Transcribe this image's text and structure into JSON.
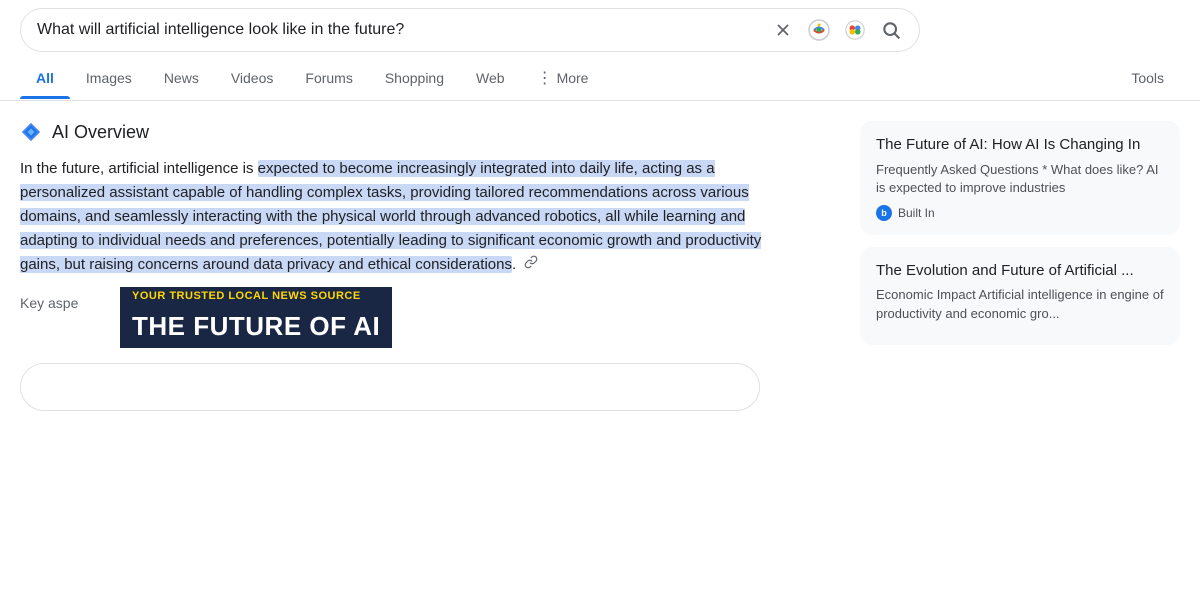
{
  "search": {
    "query": "What will artificial intelligence look like in the future?",
    "placeholder": "Search"
  },
  "nav": {
    "tabs": [
      {
        "label": "All",
        "active": true
      },
      {
        "label": "Images",
        "active": false
      },
      {
        "label": "News",
        "active": false
      },
      {
        "label": "Videos",
        "active": false
      },
      {
        "label": "Forums",
        "active": false
      },
      {
        "label": "Shopping",
        "active": false
      },
      {
        "label": "Web",
        "active": false
      },
      {
        "label": "More",
        "active": false
      }
    ],
    "tools_label": "Tools"
  },
  "ai_overview": {
    "title": "AI Overview",
    "text_before": "In the future, artificial intelligence is ",
    "text_highlighted": "expected to become increasingly integrated into daily life, acting as a personalized assistant capable of handling complex tasks, providing tailored recommendations across various domains, and seamlessly interacting with the physical world through advanced robotics, all while learning and adapting to individual needs and preferences, potentially leading to significant economic growth and productivity gains, but raising concerns around data privacy and ethical considerations",
    "text_after": ".",
    "key_aspects_label": "Key aspe"
  },
  "news_banner": {
    "top_line": "YOUR TRUSTED LOCAL NEWS SOURCE",
    "bottom_line": "THE FUTURE OF AI"
  },
  "right_panel": {
    "cards": [
      {
        "title": "The Future of AI: How AI Is Changing In",
        "snippet": "Frequently Asked Questions * What does like? AI is expected to improve industries",
        "source_icon": "b",
        "source_name": "Built In"
      },
      {
        "title": "The Evolution and Future of Artificial ...",
        "snippet": "Economic Impact Artificial intelligence in engine of productivity and economic gro...",
        "source_icon": "",
        "source_name": ""
      }
    ]
  }
}
